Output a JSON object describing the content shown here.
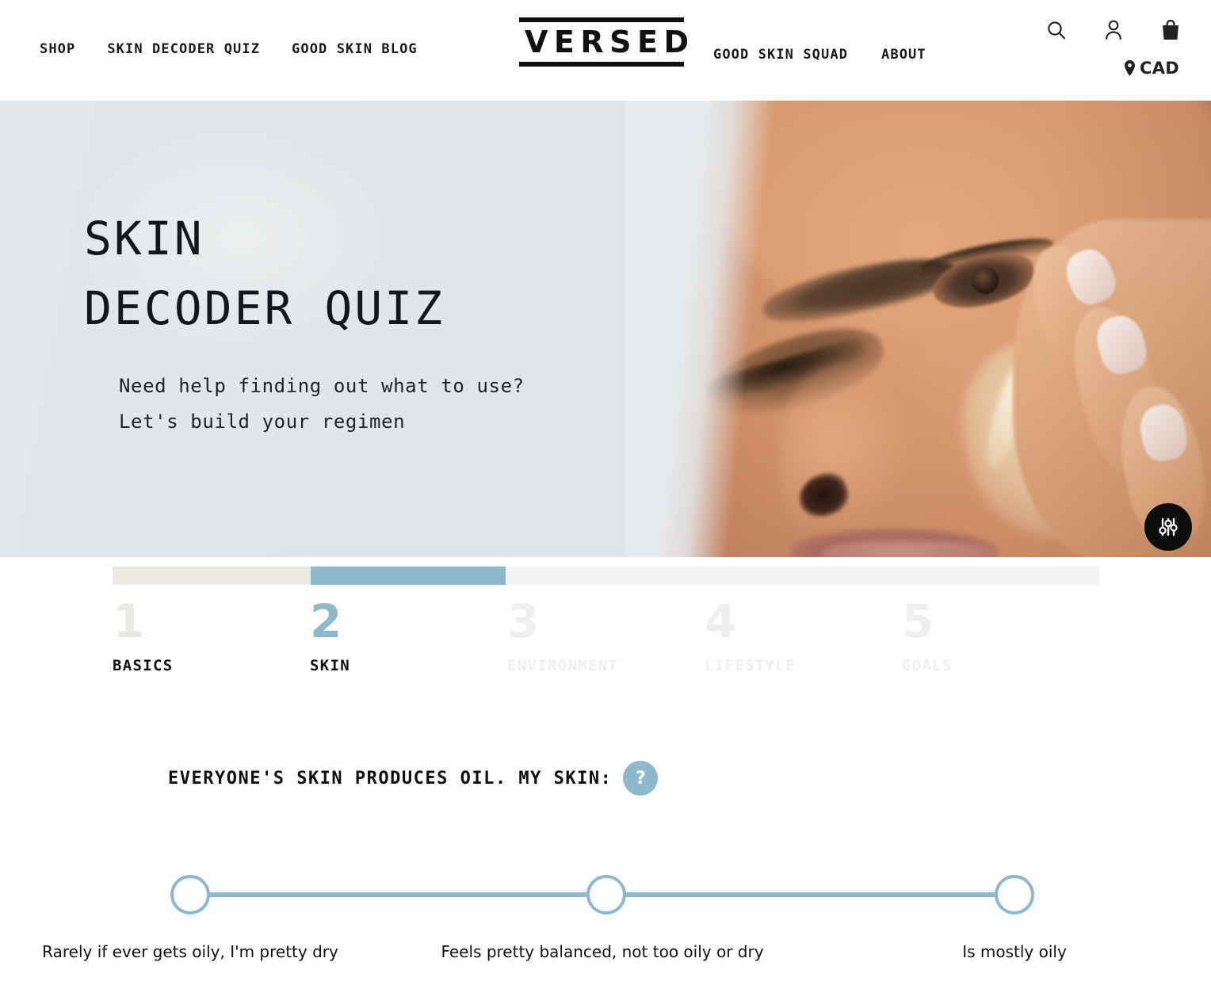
{
  "header": {
    "nav_left": [
      {
        "label": "SHOP",
        "name": "nav-shop"
      },
      {
        "label": "SKIN DECODER QUIZ",
        "name": "nav-skin-decoder-quiz"
      },
      {
        "label": "GOOD SKIN BLOG",
        "name": "nav-good-skin-blog"
      }
    ],
    "logo": "VERSED",
    "nav_right": [
      {
        "label": "GOOD SKIN SQUAD",
        "name": "nav-good-skin-squad"
      },
      {
        "label": "ABOUT",
        "name": "nav-about"
      }
    ],
    "icons": [
      "search-icon",
      "account-icon",
      "shopping-bag-icon"
    ],
    "currency": "CAD",
    "currency_icon": "location-pin-icon"
  },
  "hero": {
    "title_line1": "SKIN",
    "title_line2": "DECODER QUIZ",
    "sub_line1": "Need help finding out what to use?",
    "sub_line2": "Let's build your regimen",
    "background_color": "#e1e5e7"
  },
  "accessibility_widget": {
    "name": "accessibility-settings-icon",
    "color": "#0d0d0d"
  },
  "progress": {
    "accent_color": "#8eb9cd",
    "done_color": "#ebe7e1",
    "track_color": "#f5f4f3",
    "current_step": 2,
    "total_steps": 5,
    "steps": [
      {
        "number": "1",
        "label": "BASICS",
        "state": "done"
      },
      {
        "number": "2",
        "label": "SKIN",
        "state": "current"
      },
      {
        "number": "3",
        "label": "ENVIRONMENT",
        "state": "todo"
      },
      {
        "number": "4",
        "label": "LIFESTYLE",
        "state": "todo"
      },
      {
        "number": "5",
        "label": "GOALS",
        "state": "todo"
      }
    ]
  },
  "question": {
    "text": "EVERYONE'S SKIN PRODUCES OIL. MY SKIN:",
    "help_glyph": "?"
  },
  "slider": {
    "options": [
      "Rarely if ever gets oily, I'm pretty dry",
      "Feels pretty balanced, not too oily or dry",
      "Is mostly oily"
    ],
    "color": "#8eb9cd"
  }
}
